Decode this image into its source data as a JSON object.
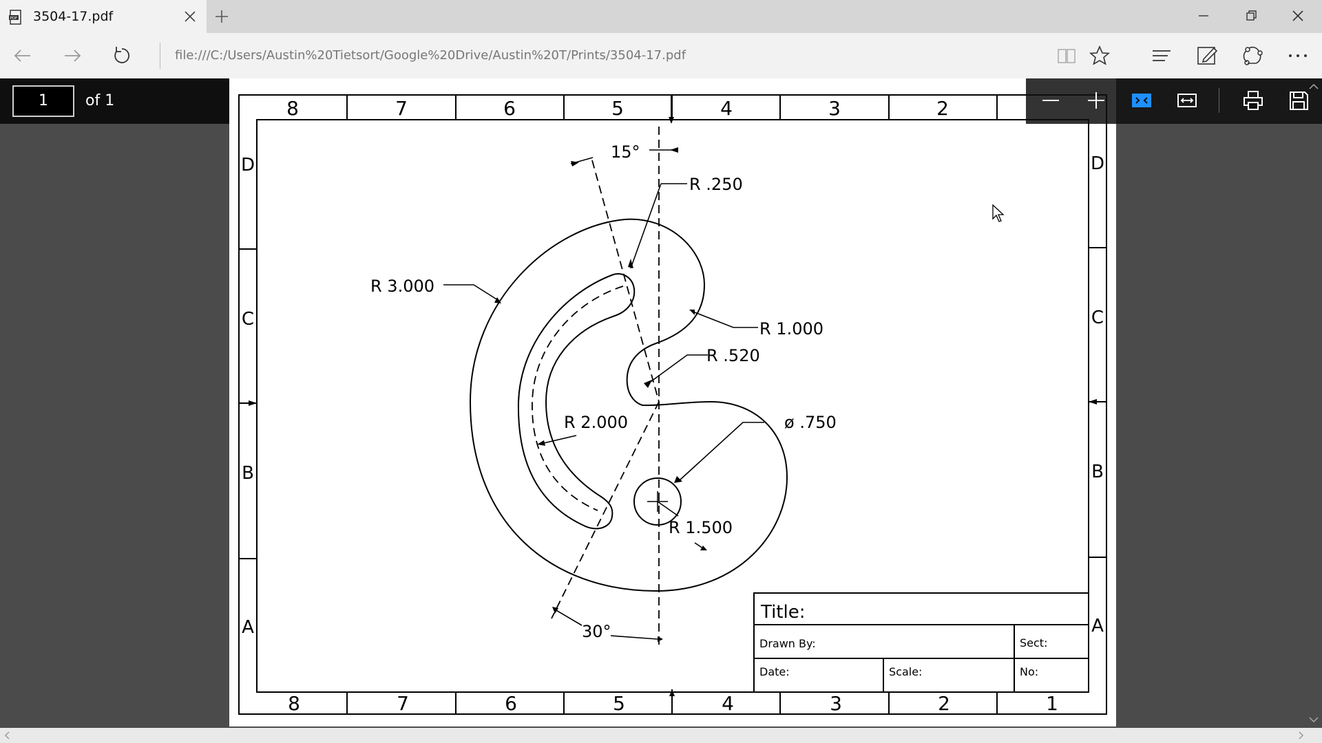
{
  "tab": {
    "title": "3504-17.pdf"
  },
  "address": {
    "url": "file:///C:/Users/Austin%20Tietsort/Google%20Drive/Austin%20T/Prints/3504-17.pdf"
  },
  "pdf_toolbar": {
    "page_value": "1",
    "page_of": "of 1"
  },
  "drawing": {
    "zones_top": [
      "8",
      "7",
      "6",
      "5",
      "4",
      "3",
      "2"
    ],
    "zones_bottom": [
      "8",
      "7",
      "6",
      "5",
      "4",
      "3",
      "2",
      "1"
    ],
    "rows": [
      "D",
      "C",
      "B",
      "A"
    ],
    "dims": {
      "angle_top": "15°",
      "r250": "R .250",
      "r3000": "R 3.000",
      "r1000": "R 1.000",
      "r520": "R .520",
      "r2000": "R 2.000",
      "dia750": "ø .750",
      "r1500": "R 1.500",
      "angle_bottom": "30°"
    },
    "title_block": {
      "title": "Title:",
      "drawn_by": "Drawn By:",
      "sect": "Sect:",
      "date": "Date:",
      "scale": "Scale:",
      "no": "No:"
    }
  }
}
